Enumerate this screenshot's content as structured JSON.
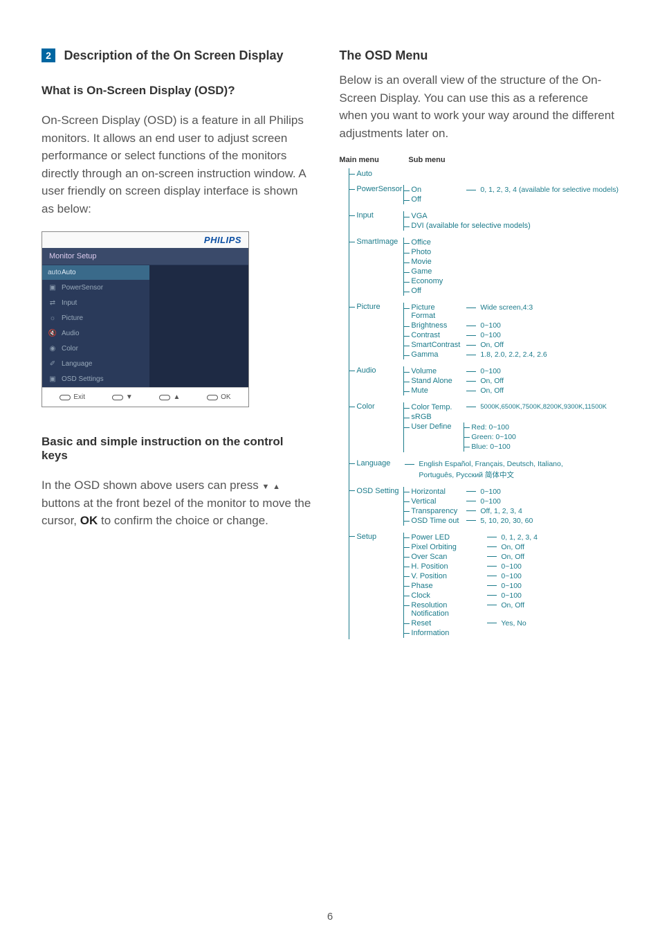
{
  "page_number": "6",
  "left": {
    "section_number": "2",
    "section_title": "Description of the On Screen Display",
    "heading_what": "What is On-Screen Display (OSD)?",
    "para1": "On-Screen Display (OSD) is a feature in all Philips monitors. It allows an end user to adjust screen performance or select functions of the monitors directly through an on-screen instruction window. A user friendly on screen display interface is shown as below:",
    "heading_basic": "Basic and simple instruction on the control keys",
    "para2a": "In the OSD shown above users can press ",
    "para2b": " buttons at the front bezel of the monitor to move the cursor, ",
    "ok": "OK",
    "para2c": " to confirm the choice or change."
  },
  "right": {
    "heading_menu": "The OSD Menu",
    "para1": "Below is an overall view of the structure of the On-Screen Display. You can use this as a reference when you want to work your way around the different adjustments later on."
  },
  "osd": {
    "logo": "PHILIPS",
    "header": "Monitor Setup",
    "items": [
      {
        "icon": "auto",
        "label": "Auto",
        "sel": true
      },
      {
        "icon": "▣",
        "label": "PowerSensor"
      },
      {
        "icon": "⇄",
        "label": "Input"
      },
      {
        "icon": "☼",
        "label": "Picture"
      },
      {
        "icon": "🔇",
        "label": "Audio"
      },
      {
        "icon": "◉",
        "label": "Color"
      },
      {
        "icon": "✐",
        "label": "Language"
      },
      {
        "icon": "▣",
        "label": "OSD Settings"
      }
    ],
    "footer": [
      "Exit",
      "▼",
      "▲",
      "OK"
    ]
  },
  "tree": {
    "h_main": "Main menu",
    "h_sub": "Sub menu",
    "auto": "Auto",
    "powersensor": {
      "label": "PowerSensor",
      "on": "On",
      "off": "Off",
      "on_val": "0, 1, 2, 3, 4 (available for selective models)"
    },
    "input": {
      "label": "Input",
      "vga": "VGA",
      "dvi": "DVI (available for selective models)"
    },
    "smartimage": {
      "label": "SmartImage",
      "items": [
        "Office",
        "Photo",
        "Movie",
        "Game",
        "Economy",
        "Off"
      ]
    },
    "picture": {
      "label": "Picture",
      "format": "Picture Format",
      "format_v": "Wide screen,4:3",
      "brightness": "Brightness",
      "brightness_v": "0~100",
      "contrast": "Contrast",
      "contrast_v": "0~100",
      "smartcontrast": "SmartContrast",
      "smartcontrast_v": "On, Off",
      "gamma": "Gamma",
      "gamma_v": "1.8, 2.0, 2.2, 2.4, 2.6"
    },
    "audio": {
      "label": "Audio",
      "volume": "Volume",
      "volume_v": "0~100",
      "standalone": "Stand Alone",
      "standalone_v": "On, Off",
      "mute": "Mute",
      "mute_v": "On, Off"
    },
    "color": {
      "label": "Color",
      "temp": "Color Temp.",
      "temp_v": "5000K,6500K,7500K,8200K,9300K,11500K",
      "srgb": "sRGB",
      "user": "User Define",
      "user_items": [
        "Red: 0~100",
        "Green: 0~100",
        "Blue: 0~100"
      ]
    },
    "language": {
      "label": "Language",
      "line1": "English  Español, Français, Deutsch, Italiano,",
      "line2": "Português, Русский  简体中文"
    },
    "osdset": {
      "label": "OSD Setting",
      "h": "Horizontal",
      "h_v": "0~100",
      "v": "Vertical",
      "v_v": "0~100",
      "t": "Transparency",
      "t_v": "Off, 1, 2, 3, 4",
      "o": "OSD Time out",
      "o_v": "5, 10, 20, 30, 60"
    },
    "setup": {
      "label": "Setup",
      "power": "Power LED",
      "power_v": "0, 1, 2, 3, 4",
      "pixel": "Pixel Orbiting",
      "pixel_v": "On, Off",
      "over": "Over Scan",
      "over_v": "On, Off",
      "hp": "H. Position",
      "hp_v": "0~100",
      "vp": "V. Position",
      "vp_v": "0~100",
      "phase": "Phase",
      "phase_v": "0~100",
      "clock": "Clock",
      "clock_v": "0~100",
      "res": "Resolution Notification",
      "res_v": "On, Off",
      "reset": "Reset",
      "reset_v": "Yes, No",
      "info": "Information"
    }
  }
}
